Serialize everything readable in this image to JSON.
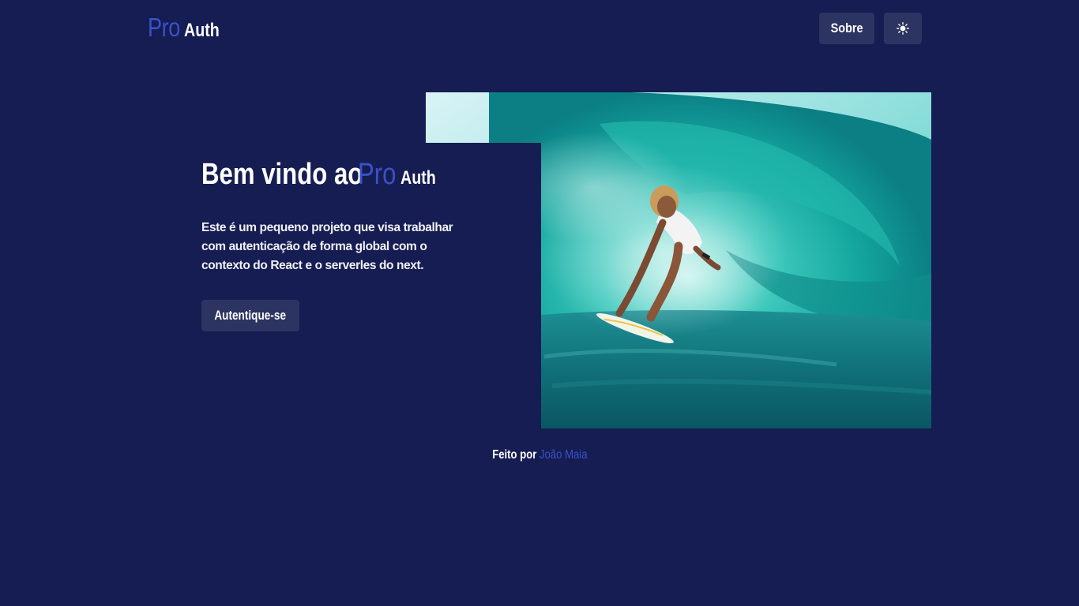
{
  "header": {
    "logo_pro": "Pro",
    "logo_auth": "Auth",
    "about_label": "Sobre",
    "theme_icon": "sun-icon"
  },
  "hero": {
    "title_text": "Bem vindo ao",
    "title_pro": "Pro",
    "title_auth": "Auth",
    "description": "Este é um pequeno projeto que visa trabalhar com autenticação de forma global com o contexto do React e o serverles do next.",
    "cta_label": "Autentique-se",
    "image_subject": "surfer riding a turquoise wave"
  },
  "footer": {
    "made_by": "Feito por",
    "author": "João Maia"
  },
  "colors": {
    "background": "#151d52",
    "accent": "#3b51c9",
    "button_bg": "#2c3462",
    "text": "#ffffff"
  }
}
